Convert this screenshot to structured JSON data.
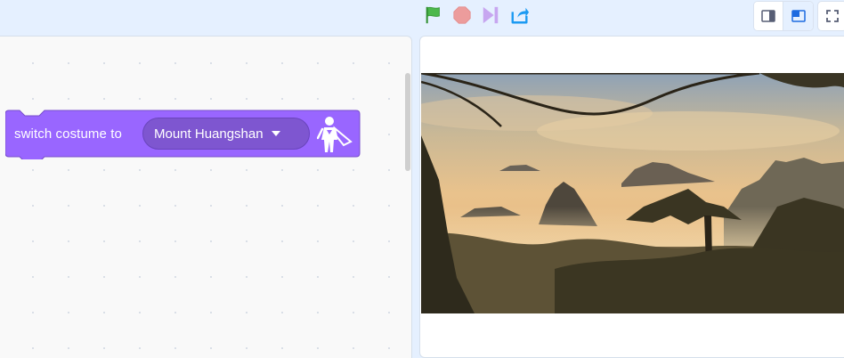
{
  "controls": {
    "green_flag": "green-flag-icon",
    "stop": "stop-icon",
    "step": "step-icon",
    "share": "share-icon"
  },
  "view_modes": [
    "small-stage-icon",
    "large-stage-icon"
  ],
  "fullscreen": "fullscreen-icon",
  "block": {
    "label": "switch costume to",
    "dropdown_value": "Mount Huangshan",
    "category_icon": "looks-superhero-icon",
    "color": "#9966ff"
  },
  "stage": {
    "image": "mountain-landscape"
  },
  "colors": {
    "flag": "#4cb84c",
    "stop": "#ec9c9c",
    "step": "#c7a6f0",
    "share": "#1c9af2",
    "looks": "#9966ff"
  }
}
